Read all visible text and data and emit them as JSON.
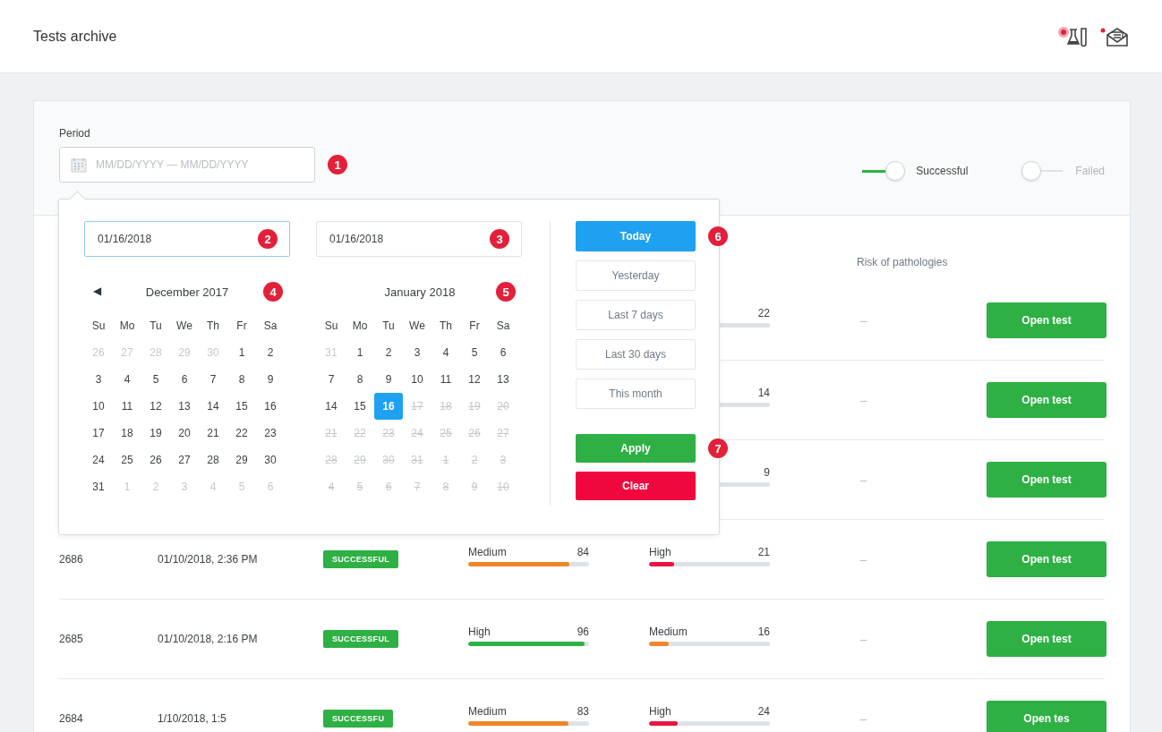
{
  "header": {
    "title": "Tests archive"
  },
  "filters": {
    "period_label": "Period",
    "period_field": {
      "placeholder": "MM/DD/YYYY — MM/DD/YYYY",
      "marker": "1"
    },
    "toggles": [
      {
        "label": "Successful",
        "on": true
      },
      {
        "label": "Failed",
        "on": false
      }
    ]
  },
  "datepicker": {
    "from_field": {
      "value": "01/16/2018",
      "focused": true,
      "marker": "2"
    },
    "to_field": {
      "value": "01/16/2018",
      "focused": false,
      "marker": "3"
    },
    "prev_arrow": "◀",
    "months": [
      {
        "title": "December 2017",
        "marker": "4",
        "weekdays": [
          "Su",
          "Mo",
          "Tu",
          "We",
          "Th",
          "Fr",
          "Sa"
        ],
        "days": [
          {
            "label": "26",
            "kind": "muted",
            "selected": false
          },
          {
            "label": "27",
            "kind": "muted",
            "selected": false
          },
          {
            "label": "28",
            "kind": "muted",
            "selected": false
          },
          {
            "label": "29",
            "kind": "muted",
            "selected": false
          },
          {
            "label": "30",
            "kind": "muted",
            "selected": false
          },
          {
            "label": "1",
            "kind": "normal",
            "selected": false
          },
          {
            "label": "2",
            "kind": "normal",
            "selected": false
          },
          {
            "label": "3",
            "kind": "normal",
            "selected": false
          },
          {
            "label": "4",
            "kind": "normal",
            "selected": false
          },
          {
            "label": "5",
            "kind": "normal",
            "selected": false
          },
          {
            "label": "6",
            "kind": "normal",
            "selected": false
          },
          {
            "label": "7",
            "kind": "normal",
            "selected": false
          },
          {
            "label": "8",
            "kind": "normal",
            "selected": false
          },
          {
            "label": "9",
            "kind": "normal",
            "selected": false
          },
          {
            "label": "10",
            "kind": "normal",
            "selected": false
          },
          {
            "label": "11",
            "kind": "normal",
            "selected": false
          },
          {
            "label": "12",
            "kind": "normal",
            "selected": false
          },
          {
            "label": "13",
            "kind": "normal",
            "selected": false
          },
          {
            "label": "14",
            "kind": "normal",
            "selected": false
          },
          {
            "label": "15",
            "kind": "normal",
            "selected": false
          },
          {
            "label": "16",
            "kind": "normal",
            "selected": false
          },
          {
            "label": "17",
            "kind": "normal",
            "selected": false
          },
          {
            "label": "18",
            "kind": "normal",
            "selected": false
          },
          {
            "label": "19",
            "kind": "normal",
            "selected": false
          },
          {
            "label": "20",
            "kind": "normal",
            "selected": false
          },
          {
            "label": "21",
            "kind": "normal",
            "selected": false
          },
          {
            "label": "22",
            "kind": "normal",
            "selected": false
          },
          {
            "label": "23",
            "kind": "normal",
            "selected": false
          },
          {
            "label": "24",
            "kind": "normal",
            "selected": false
          },
          {
            "label": "25",
            "kind": "normal",
            "selected": false
          },
          {
            "label": "26",
            "kind": "normal",
            "selected": false
          },
          {
            "label": "27",
            "kind": "normal",
            "selected": false
          },
          {
            "label": "28",
            "kind": "normal",
            "selected": false
          },
          {
            "label": "29",
            "kind": "normal",
            "selected": false
          },
          {
            "label": "30",
            "kind": "normal",
            "selected": false
          },
          {
            "label": "31",
            "kind": "normal",
            "selected": false
          },
          {
            "label": "1",
            "kind": "muted",
            "selected": false
          },
          {
            "label": "2",
            "kind": "muted",
            "selected": false
          },
          {
            "label": "3",
            "kind": "muted",
            "selected": false
          },
          {
            "label": "4",
            "kind": "muted",
            "selected": false
          },
          {
            "label": "5",
            "kind": "muted",
            "selected": false
          },
          {
            "label": "6",
            "kind": "muted",
            "selected": false
          }
        ]
      },
      {
        "title": "January 2018",
        "marker": "5",
        "weekdays": [
          "Su",
          "Mo",
          "Tu",
          "We",
          "Th",
          "Fr",
          "Sa"
        ],
        "days": [
          {
            "label": "31",
            "kind": "muted",
            "selected": false
          },
          {
            "label": "1",
            "kind": "normal",
            "selected": false
          },
          {
            "label": "2",
            "kind": "normal",
            "selected": false
          },
          {
            "label": "3",
            "kind": "normal",
            "selected": false
          },
          {
            "label": "4",
            "kind": "normal",
            "selected": false
          },
          {
            "label": "5",
            "kind": "normal",
            "selected": false
          },
          {
            "label": "6",
            "kind": "normal",
            "selected": false
          },
          {
            "label": "7",
            "kind": "normal",
            "selected": false
          },
          {
            "label": "8",
            "kind": "normal",
            "selected": false
          },
          {
            "label": "9",
            "kind": "normal",
            "selected": false
          },
          {
            "label": "10",
            "kind": "normal",
            "selected": false
          },
          {
            "label": "11",
            "kind": "normal",
            "selected": false
          },
          {
            "label": "12",
            "kind": "normal",
            "selected": false
          },
          {
            "label": "13",
            "kind": "normal",
            "selected": false
          },
          {
            "label": "14",
            "kind": "normal",
            "selected": false
          },
          {
            "label": "15",
            "kind": "normal",
            "selected": false
          },
          {
            "label": "16",
            "kind": "normal",
            "selected": true
          },
          {
            "label": "17",
            "kind": "disabled",
            "selected": false
          },
          {
            "label": "18",
            "kind": "disabled",
            "selected": false
          },
          {
            "label": "19",
            "kind": "disabled",
            "selected": false
          },
          {
            "label": "20",
            "kind": "disabled",
            "selected": false
          },
          {
            "label": "21",
            "kind": "disabled",
            "selected": false
          },
          {
            "label": "22",
            "kind": "disabled",
            "selected": false
          },
          {
            "label": "23",
            "kind": "disabled",
            "selected": false
          },
          {
            "label": "24",
            "kind": "disabled",
            "selected": false
          },
          {
            "label": "25",
            "kind": "disabled",
            "selected": false
          },
          {
            "label": "26",
            "kind": "disabled",
            "selected": false
          },
          {
            "label": "27",
            "kind": "disabled",
            "selected": false
          },
          {
            "label": "28",
            "kind": "disabled",
            "selected": false
          },
          {
            "label": "29",
            "kind": "disabled",
            "selected": false
          },
          {
            "label": "30",
            "kind": "disabled",
            "selected": false
          },
          {
            "label": "31",
            "kind": "disabled",
            "selected": false
          },
          {
            "label": "1",
            "kind": "disabled",
            "selected": false
          },
          {
            "label": "2",
            "kind": "disabled",
            "selected": false
          },
          {
            "label": "3",
            "kind": "disabled",
            "selected": false
          },
          {
            "label": "4",
            "kind": "disabled",
            "selected": false
          },
          {
            "label": "5",
            "kind": "disabled",
            "selected": false
          },
          {
            "label": "6",
            "kind": "disabled",
            "selected": false
          },
          {
            "label": "7",
            "kind": "disabled",
            "selected": false
          },
          {
            "label": "8",
            "kind": "disabled",
            "selected": false
          },
          {
            "label": "9",
            "kind": "disabled",
            "selected": false
          },
          {
            "label": "10",
            "kind": "disabled",
            "selected": false
          }
        ]
      }
    ],
    "presets": [
      {
        "label": "Today",
        "selected": true,
        "marker": "6"
      },
      {
        "label": "Yesterday",
        "selected": false
      },
      {
        "label": "Last 7 days",
        "selected": false
      },
      {
        "label": "Last 30 days",
        "selected": false
      },
      {
        "label": "This month",
        "selected": false
      }
    ],
    "actions": [
      {
        "label": "Apply",
        "kind": "apply",
        "marker": "7"
      },
      {
        "label": "Clear",
        "kind": "clear"
      }
    ]
  },
  "table": {
    "columns": [
      {
        "label": "Risk of pathologies"
      }
    ],
    "rows": [
      {
        "metric_2": {
          "value": "22"
        },
        "risk": "–",
        "action": "Open test"
      },
      {
        "metric_2": {
          "value": "14"
        },
        "risk": "–",
        "action": "Open test"
      },
      {
        "metric_2": {
          "value": "9"
        },
        "risk": "–",
        "action": "Open test"
      },
      {
        "id": "2686",
        "date": "01/10/2018, 2:36 PM",
        "status": "SUCCESSFUL",
        "metric_1": {
          "label": "Medium",
          "value": "84",
          "level": 0.84,
          "color": "#f0862a"
        },
        "metric_2": {
          "label": "High",
          "value": "21",
          "level": 0.21,
          "color": "#e8173f"
        },
        "risk": "–",
        "action": "Open test"
      },
      {
        "id": "2685",
        "date": "01/10/2018, 2:16 PM",
        "status": "SUCCESSFUL",
        "metric_1": {
          "label": "High",
          "value": "96",
          "level": 0.96,
          "color": "#2eb044"
        },
        "metric_2": {
          "label": "Medium",
          "value": "16",
          "level": 0.16,
          "color": "#f0862a"
        },
        "risk": "–",
        "action": "Open test"
      },
      {
        "id": "2684",
        "date": "1/10/2018, 1:5",
        "status": "SUCCESSFU",
        "metric_1": {
          "label": "Medium",
          "value": "83",
          "level": 0.83,
          "color": "#f0862a"
        },
        "metric_2": {
          "label": "High",
          "value": "24",
          "level": 0.24,
          "color": "#e8173f"
        },
        "risk": "–",
        "action": "Open tes"
      }
    ]
  }
}
